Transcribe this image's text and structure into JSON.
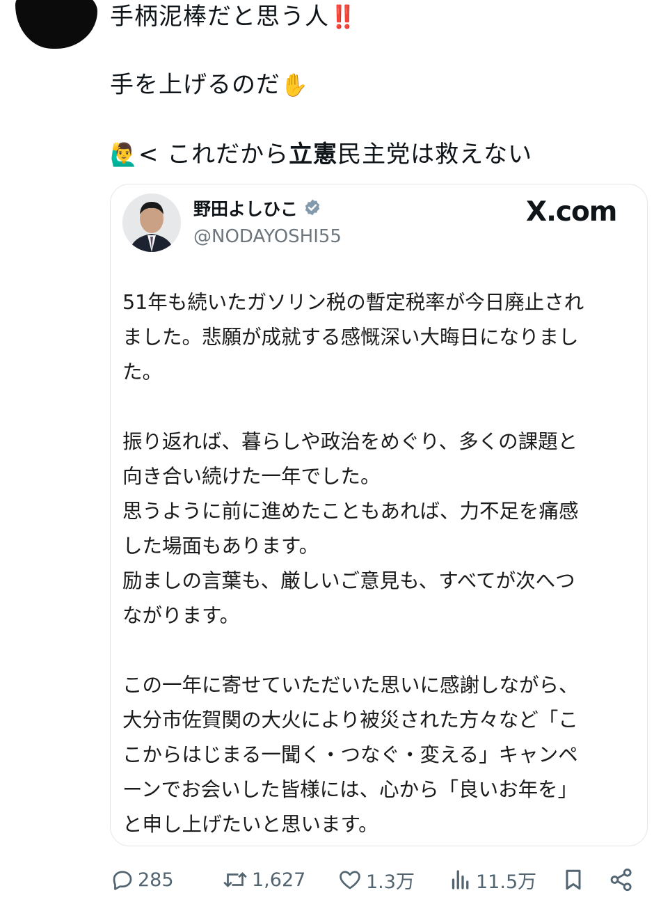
{
  "post": {
    "line1": "手柄泥棒だと思う人",
    "line1_emoji": "‼️",
    "line2": "手を上げるのだ",
    "line2_emoji": "✋",
    "line3_emoji": "🙋‍♂️",
    "line3_prefix": "< これだから",
    "line3_bold": "立憲",
    "line3_suffix": "民主党は救えない"
  },
  "card": {
    "author_name": "野田よしひこ",
    "handle": "@NODAYOSHI55",
    "site": "X.com",
    "verified_color": "#829aab",
    "paragraphs": [
      "51年も続いたガソリン税の暫定税率が今日廃止され\nました。悲願が成就する感慨深い大晦日になりまし\nた。",
      "振り返れば、暮らしや政治をめぐり、多くの課題と\n向き合い続けた一年でした。\n思うように前に進めたこともあれば、力不足を痛感\nした場面もあります。\n励ましの言葉も、厳しいご意見も、すべてが次へつ\nながります。",
      "この一年に寄せていただいた思いに感謝しながら、\n大分市佐賀関の大火により被災された方々など「こ\nこからはじまる一聞く・つなぐ・変える」キャンペ\nーンでお会いした皆様には、心から「良いお年を」\nと申し上げたいと思います。"
    ]
  },
  "actions": {
    "replies": "285",
    "reposts": "1,627",
    "likes": "1.3万",
    "views": "11.5万",
    "icon_color": "#536471"
  }
}
